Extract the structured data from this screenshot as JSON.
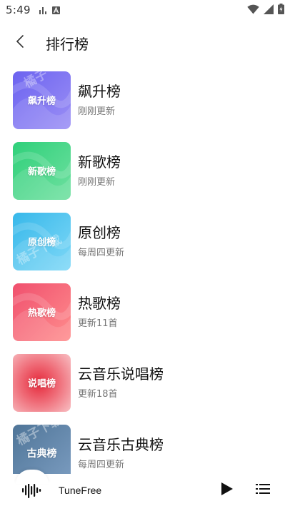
{
  "status_bar": {
    "time": "5:49",
    "left_icons": [
      "signal-bars-icon",
      "text-a-icon"
    ],
    "right_icons": [
      "wifi-icon",
      "cell-signal-icon",
      "battery-icon"
    ]
  },
  "header": {
    "back_icon": "chevron-left-icon",
    "title": "排行榜"
  },
  "charts": [
    {
      "cover_label": "飙升榜",
      "title": "飙升榜",
      "subtitle": "刚刚更新",
      "gradient": [
        "#6c63f0",
        "#9b8ff5"
      ]
    },
    {
      "cover_label": "新歌榜",
      "title": "新歌榜",
      "subtitle": "刚刚更新",
      "gradient": [
        "#2fd07a",
        "#6fe0a0"
      ]
    },
    {
      "cover_label": "原创榜",
      "title": "原创榜",
      "subtitle": "每周四更新",
      "gradient": [
        "#37b8ea",
        "#7fd8f7"
      ]
    },
    {
      "cover_label": "热歌榜",
      "title": "热歌榜",
      "subtitle": "更新11首",
      "gradient": [
        "#f0506e",
        "#ff8d8d"
      ]
    },
    {
      "cover_label": "说唱榜",
      "title": "云音乐说唱榜",
      "subtitle": "更新18首",
      "gradient": [
        "#e93a4a",
        "#f7b3b8"
      ]
    },
    {
      "cover_label": "古典榜",
      "title": "云音乐古典榜",
      "subtitle": "每周四更新",
      "gradient": [
        "#4f7598",
        "#7b9cc0"
      ]
    }
  ],
  "watermarks": [
    "橘子",
    "橘子下载",
    "橘子下载"
  ],
  "player": {
    "track_name": "TuneFree",
    "icons": [
      "sound-wave-icon",
      "play-icon",
      "playlist-icon"
    ]
  }
}
